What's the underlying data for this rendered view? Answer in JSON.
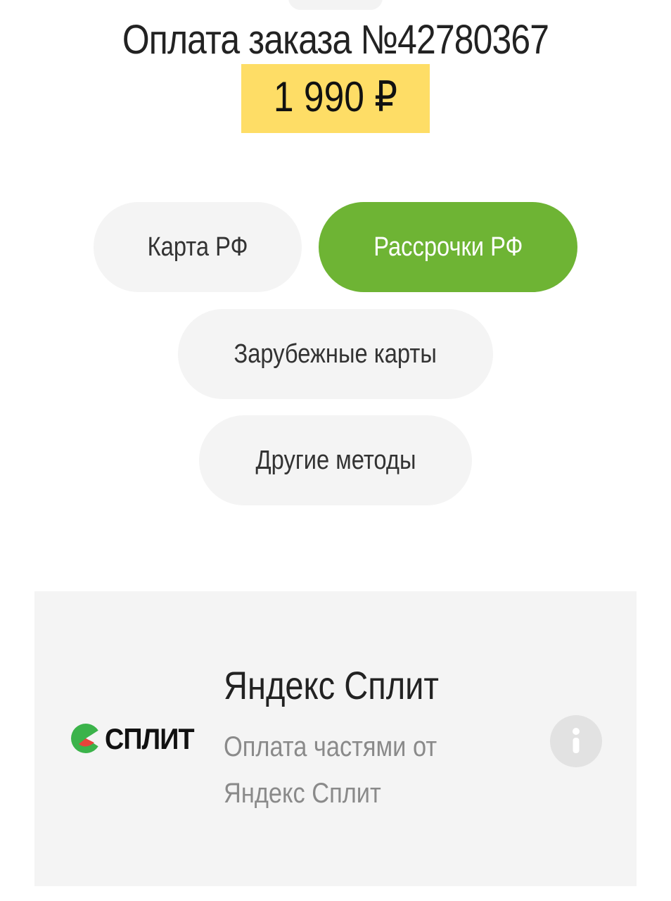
{
  "header": {
    "title": "Оплата заказа №42780367",
    "amount": "1 990 ₽"
  },
  "payment_tabs": [
    {
      "label": "Карта РФ",
      "active": false
    },
    {
      "label": "Рассрочки РФ",
      "active": true
    },
    {
      "label": "Зарубежные карты",
      "active": false
    },
    {
      "label": "Другие методы",
      "active": false
    }
  ],
  "method": {
    "logo_text": "СПЛИТ",
    "name": "Яндекс Сплит",
    "description": "Оплата частями от Яндекс Сплит",
    "info_icon": "info-icon"
  },
  "colors": {
    "accent_green": "#6eb434",
    "amount_highlight": "#fedd66",
    "pill_background": "#f4f4f4",
    "card_background": "#f4f4f4"
  }
}
